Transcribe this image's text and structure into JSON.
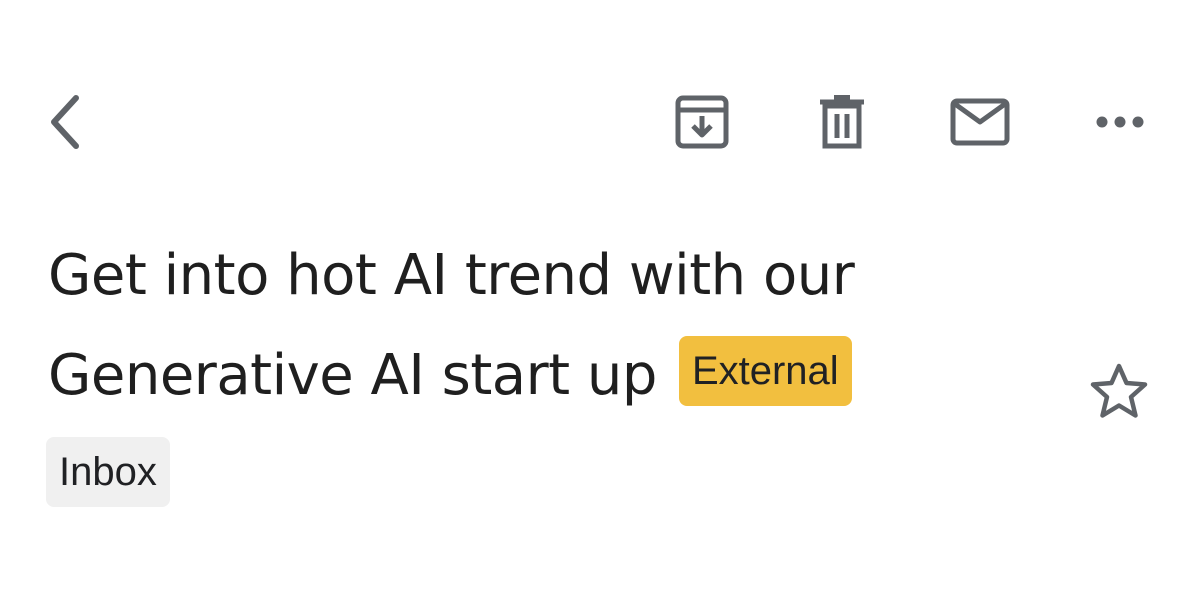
{
  "toolbar": {
    "back_icon": "chevron-left-icon",
    "archive_icon": "archive-icon",
    "delete_icon": "trash-icon",
    "mark_unread_icon": "mail-icon",
    "more_icon": "more-horizontal-icon",
    "icon_color": "#5f6368"
  },
  "message": {
    "subject_line_1": "Get into hot AI trend with our",
    "subject_line_2": "Generative AI start up",
    "external_badge": "External",
    "external_badge_color": "#f2bf3f",
    "star_icon": "star-outline-icon",
    "starred": false,
    "label_chip": "Inbox",
    "label_chip_color": "#f0f0f0"
  }
}
